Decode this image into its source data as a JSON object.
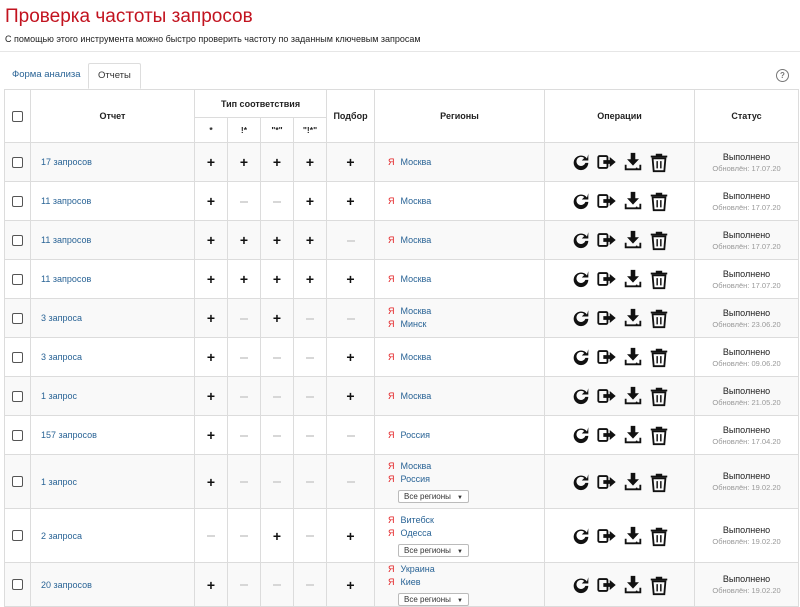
{
  "page": {
    "title": "Проверка частоты запросов",
    "subtitle": "С помощью этого инструмента можно быстро проверить частоту по заданным ключевым запросам"
  },
  "tabs": [
    {
      "label": "Форма анализа",
      "active": false
    },
    {
      "label": "Отчеты",
      "active": true
    }
  ],
  "help": {
    "icon": "question-circle-icon",
    "glyph": "?"
  },
  "table": {
    "headers": {
      "report": "Отчет",
      "match_type": "Тип соответствия",
      "match_sub": [
        "*",
        "!*",
        "\"*\"",
        "\"!*\""
      ],
      "selection": "Подбор",
      "regions": "Регионы",
      "operations": "Операции",
      "status": "Статус"
    },
    "region_select_label": "Все регионы",
    "yandex_glyph": "Я",
    "rows": [
      {
        "name": "17 запросов",
        "m": [
          "+",
          "+",
          "+",
          "+"
        ],
        "sel": "+",
        "regions": [
          "Москва"
        ],
        "select": false,
        "status": "Выполнено",
        "date": "Обновлён: 17.07.20"
      },
      {
        "name": "11 запросов",
        "m": [
          "+",
          "-",
          "-",
          "+"
        ],
        "sel": "+",
        "regions": [
          "Москва"
        ],
        "select": false,
        "status": "Выполнено",
        "date": "Обновлён: 17.07.20"
      },
      {
        "name": "11 запросов",
        "m": [
          "+",
          "+",
          "+",
          "+"
        ],
        "sel": "-",
        "regions": [
          "Москва"
        ],
        "select": false,
        "status": "Выполнено",
        "date": "Обновлён: 17.07.20"
      },
      {
        "name": "11 запросов",
        "m": [
          "+",
          "+",
          "+",
          "+"
        ],
        "sel": "+",
        "regions": [
          "Москва"
        ],
        "select": false,
        "status": "Выполнено",
        "date": "Обновлён: 17.07.20"
      },
      {
        "name": "3 запроса",
        "m": [
          "+",
          "-",
          "+",
          "-"
        ],
        "sel": "-",
        "regions": [
          "Москва",
          "Минск"
        ],
        "select": false,
        "status": "Выполнено",
        "date": "Обновлён: 23.06.20"
      },
      {
        "name": "3 запроса",
        "m": [
          "+",
          "-",
          "-",
          "-"
        ],
        "sel": "+",
        "regions": [
          "Москва"
        ],
        "select": false,
        "status": "Выполнено",
        "date": "Обновлён: 09.06.20"
      },
      {
        "name": "1 запрос",
        "m": [
          "+",
          "-",
          "-",
          "-"
        ],
        "sel": "+",
        "regions": [
          "Москва"
        ],
        "select": false,
        "status": "Выполнено",
        "date": "Обновлён: 21.05.20"
      },
      {
        "name": "157 запросов",
        "m": [
          "+",
          "-",
          "-",
          "-"
        ],
        "sel": "-",
        "regions": [
          "Россия"
        ],
        "select": false,
        "status": "Выполнено",
        "date": "Обновлён: 17.04.20"
      },
      {
        "name": "1 запрос",
        "m": [
          "+",
          "-",
          "-",
          "-"
        ],
        "sel": "-",
        "regions": [
          "Москва",
          "Россия"
        ],
        "select": true,
        "status": "Выполнено",
        "date": "Обновлён: 19.02.20"
      },
      {
        "name": "2 запроса",
        "m": [
          "-",
          "-",
          "+",
          "-"
        ],
        "sel": "+",
        "regions": [
          "Витебск",
          "Одесса"
        ],
        "select": true,
        "status": "Выполнено",
        "date": "Обновлён: 19.02.20"
      },
      {
        "name": "20 запросов",
        "m": [
          "+",
          "-",
          "-",
          "-"
        ],
        "sel": "+",
        "regions": [
          "Украина",
          "Киев"
        ],
        "select": true,
        "status": "Выполнено",
        "date": "Обновлён: 19.02.20"
      }
    ]
  },
  "operation_icons": [
    "refresh-icon",
    "export-icon",
    "download-icon",
    "trash-icon"
  ]
}
